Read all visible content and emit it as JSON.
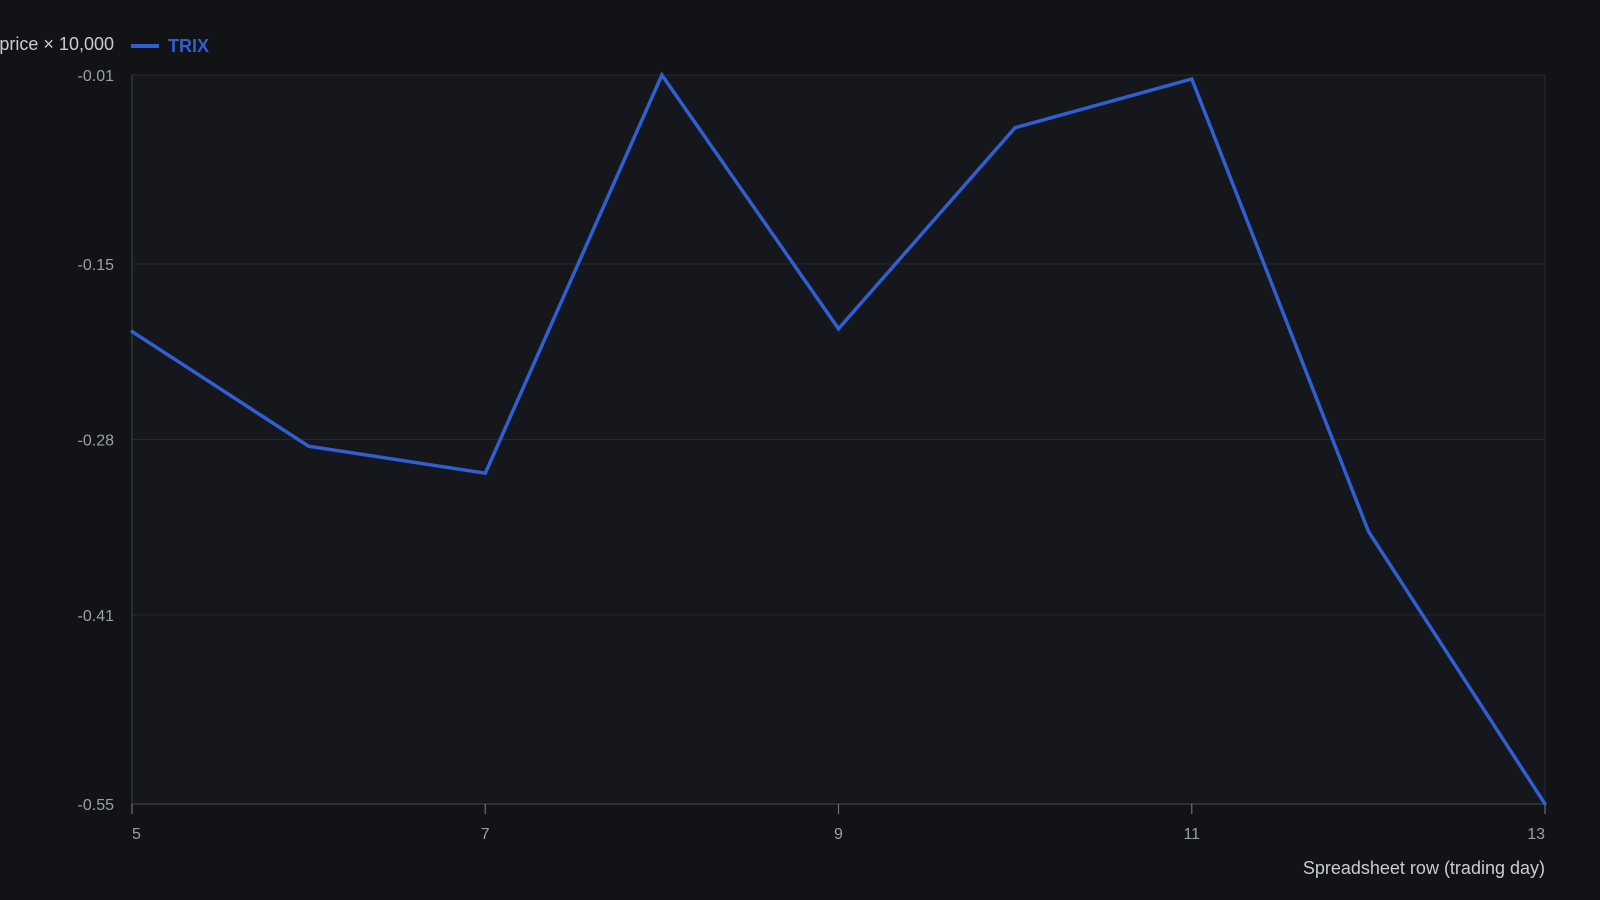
{
  "chart_data": {
    "type": "line",
    "title": "",
    "xlabel": "Spreadsheet row (trading day)",
    "ylabel": "price × 10,000",
    "x": [
      5,
      6,
      7,
      8,
      9,
      10,
      11,
      12,
      13
    ],
    "xlim": [
      5,
      13
    ],
    "ylim": [
      -0.55,
      -0.01
    ],
    "x_ticks": [
      "5",
      "7",
      "9",
      "11",
      "13"
    ],
    "y_ticks": [
      "-0.01",
      "-0.15",
      "-0.28",
      "-0.41",
      "-0.55"
    ],
    "grid": true,
    "legend": "top-left",
    "series": [
      {
        "name": "TRIX",
        "color": "#2f5fd0",
        "values": [
          -0.2,
          -0.285,
          -0.305,
          -0.01,
          -0.198,
          -0.049,
          -0.013,
          -0.348,
          -0.55
        ]
      }
    ]
  },
  "colors": {
    "background": "#111317",
    "plot_background": "#15171c",
    "series": "#2f5fd0"
  }
}
